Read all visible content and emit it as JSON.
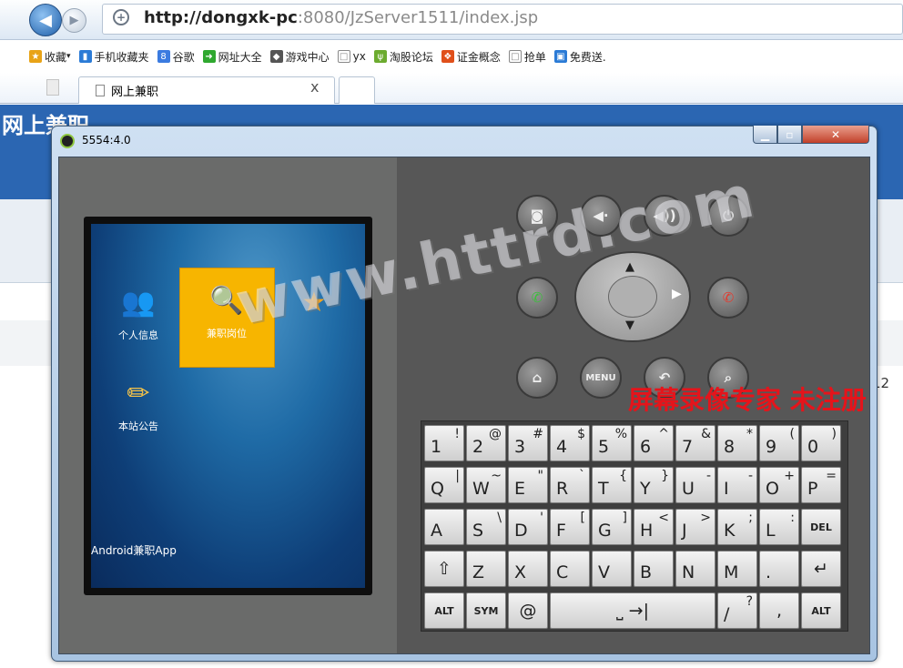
{
  "browser": {
    "url_host": "http://dongxk-pc",
    "url_rest": ":8080/JzServer1511/index.jsp",
    "favorites": [
      {
        "label": "收藏",
        "icon": "star-add-icon",
        "color": "#e8a317"
      },
      {
        "label": "手机收藏夹",
        "icon": "phone-icon",
        "color": "#2b7bd6"
      },
      {
        "label": "谷歌",
        "icon": "google-icon",
        "color": "#3b7be0"
      },
      {
        "label": "网址大全",
        "icon": "globe-icon",
        "color": "#2fa82f"
      },
      {
        "label": "游戏中心",
        "icon": "gamepad-icon",
        "color": "#555555"
      },
      {
        "label": "yx",
        "icon": "page-icon",
        "color": "#888888"
      },
      {
        "label": "淘股论坛",
        "icon": "bamboo-icon",
        "color": "#6cab2f"
      },
      {
        "label": "证金概念",
        "icon": "flame-icon",
        "color": "#e0501b"
      },
      {
        "label": "抢单",
        "icon": "page-icon",
        "color": "#888888"
      },
      {
        "label": "免费送.",
        "icon": "gift-icon",
        "color": "#2b7bd6"
      }
    ],
    "tab": {
      "title": "网上兼职",
      "close": "x"
    }
  },
  "page": {
    "title": "网上兼职",
    "number": "12"
  },
  "emulator": {
    "title": "5554:4.0",
    "apps": [
      {
        "label": "个人信息",
        "icon": "person-icon"
      },
      {
        "label": "兼职岗位",
        "icon": "search-icon"
      },
      {
        "label": "",
        "icon": "star-icon"
      },
      {
        "label": "本站公告",
        "icon": "pencil-icon"
      }
    ],
    "app_name": "Android兼职App",
    "hw_buttons": [
      "camera",
      "volume-down",
      "volume-up",
      "power"
    ],
    "nav_buttons": {
      "home": "⌂",
      "menu": "MENU",
      "back": "↶",
      "search": "⌕"
    },
    "keyboard": {
      "row1": [
        [
          "1",
          "!"
        ],
        [
          "2",
          "@"
        ],
        [
          "3",
          "#"
        ],
        [
          "4",
          "$"
        ],
        [
          "5",
          "%"
        ],
        [
          "6",
          "^"
        ],
        [
          "7",
          "&"
        ],
        [
          "8",
          "*"
        ],
        [
          "9",
          "("
        ],
        [
          "0",
          ")"
        ]
      ],
      "row2": [
        [
          "Q",
          "|"
        ],
        [
          "W",
          "~"
        ],
        [
          "E",
          "\""
        ],
        [
          "R",
          "`"
        ],
        [
          "T",
          "{"
        ],
        [
          "Y",
          "}"
        ],
        [
          "U",
          "-"
        ],
        [
          "I",
          "-"
        ],
        [
          "O",
          "+"
        ],
        [
          "P",
          "="
        ]
      ],
      "row3": [
        [
          "A",
          ""
        ],
        [
          "S",
          "\\"
        ],
        [
          "D",
          "'"
        ],
        [
          "F",
          "["
        ],
        [
          "G",
          "]"
        ],
        [
          "H",
          "<"
        ],
        [
          "J",
          ">"
        ],
        [
          "K",
          ";"
        ],
        [
          "L",
          ":"
        ]
      ],
      "row4": [
        [
          "Z",
          ""
        ],
        [
          "X",
          ""
        ],
        [
          "C",
          ""
        ],
        [
          "V",
          ""
        ],
        [
          "B",
          ""
        ],
        [
          "N",
          ""
        ],
        [
          "M",
          ""
        ],
        [
          ".",
          ""
        ]
      ],
      "del": "DEL",
      "alt": "ALT",
      "sym": "SYM",
      "at": "@",
      "slash": "/",
      "slash_alt": "?",
      "comma": ","
    }
  },
  "watermark": "www.httrd.com",
  "recorder_notice": "屏幕录像专家 未注册"
}
